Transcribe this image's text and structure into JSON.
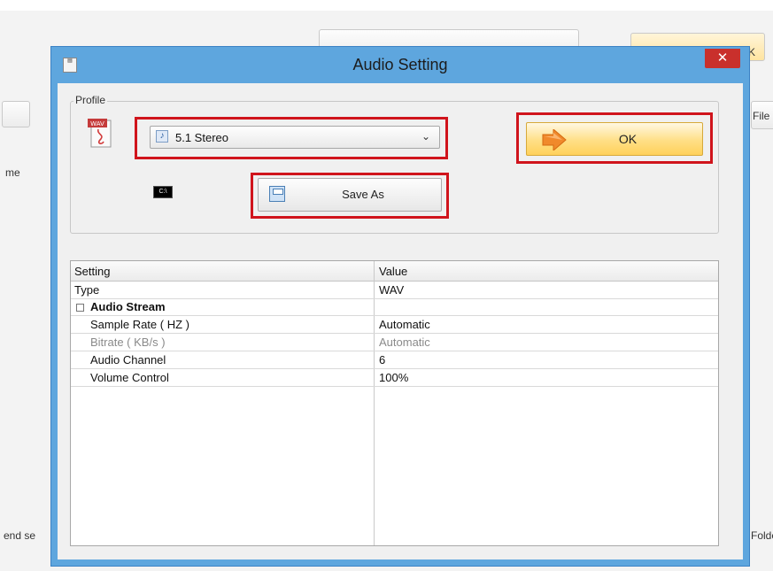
{
  "background": {
    "left_labels": [
      "me",
      "end se"
    ],
    "right_labels": [
      "File",
      "Folde"
    ],
    "partial_ok": "K"
  },
  "dialog": {
    "title": "Audio Setting",
    "close_glyph": "✕",
    "profile": {
      "group_label": "Profile",
      "wav_label": "WAV",
      "selected_profile": "5.1 Stereo",
      "ok_label": "OK",
      "cmd_label": "C:\\",
      "save_as_label": "Save As"
    },
    "settings": {
      "headers": [
        "Setting",
        "Value"
      ],
      "rows": [
        {
          "setting": "Type",
          "value": "WAV"
        },
        {
          "setting": "Audio Stream",
          "value": "",
          "group": true,
          "expander": "⊟"
        },
        {
          "setting": "Sample Rate ( HZ )",
          "value": "Automatic"
        },
        {
          "setting": "Bitrate ( KB/s )",
          "value": "Automatic",
          "disabled": true
        },
        {
          "setting": "Audio Channel",
          "value": "6"
        },
        {
          "setting": "Volume Control",
          "value": "100%"
        }
      ]
    }
  },
  "colors": {
    "dialog_frame": "#5ea6de",
    "close_button": "#c9302c",
    "highlight": "#d0141c",
    "ok_button": "#ffdf86"
  },
  "icons": {
    "title_icon": "app-icon",
    "wav_icon": "wav-file-icon",
    "note_icon": "music-note-icon",
    "dropdown": "chevron-down-icon",
    "ok_arrow": "orange-arrow-icon",
    "cmd": "command-prompt-icon",
    "save": "floppy-disk-icon",
    "collapse": "minus-box-icon"
  }
}
